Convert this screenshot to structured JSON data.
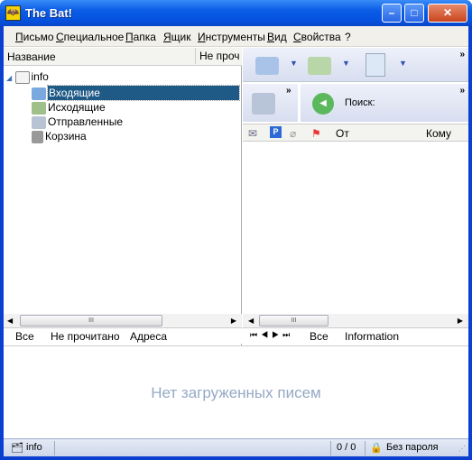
{
  "window": {
    "title": "The Bat!"
  },
  "menu": [
    "Письмо",
    "Специальное",
    "Папка",
    "Ящик",
    "Инструменты",
    "Вид",
    "Свойства",
    "?"
  ],
  "folders": {
    "columns": [
      "Название",
      "Не проч"
    ],
    "account": "info",
    "items": [
      {
        "label": "Входящие",
        "icon": "inbox-icon",
        "selected": true
      },
      {
        "label": "Исходящие",
        "icon": "outbox-icon"
      },
      {
        "label": "Отправленные",
        "icon": "sent-folder-icon"
      },
      {
        "label": "Корзина",
        "icon": "trash-icon"
      }
    ],
    "tabs": [
      "Все",
      "Не прочитано",
      "Адреса"
    ]
  },
  "toolbar": {
    "search_label": "Поиск:"
  },
  "messages": {
    "columns": [
      "От",
      "Кому"
    ],
    "tabs": [
      "Все",
      "Information"
    ]
  },
  "preview": {
    "empty_text": "Нет загруженных писем"
  },
  "status": {
    "account": "info",
    "count": "0 / 0",
    "password": "Без пароля"
  }
}
